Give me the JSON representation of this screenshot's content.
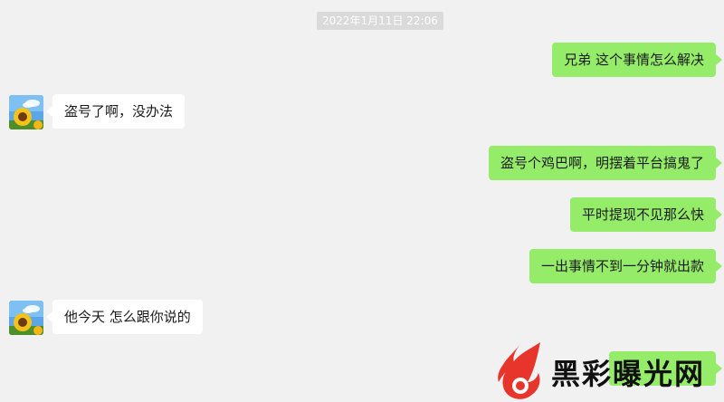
{
  "chat": {
    "timestamp": "2022年1月11日 22:06",
    "messages": [
      {
        "side": "out",
        "text": "兄弟 这个事情怎么解决"
      },
      {
        "side": "in",
        "text": "盗号了啊，没办法"
      },
      {
        "side": "out",
        "text": "盗号个鸡巴啊，明摆着平台搞鬼了"
      },
      {
        "side": "out",
        "text": "平时提现不见那么快"
      },
      {
        "side": "out",
        "text": "一出事情不到一分钟就出款"
      },
      {
        "side": "in",
        "text": "他今天 怎么跟你说的"
      }
    ]
  },
  "watermark": {
    "text": "黑彩曝光网"
  },
  "colors": {
    "background": "#f1f1f1",
    "outgoing_bubble": "#95ec69",
    "incoming_bubble": "#ffffff",
    "watermark_red": "#e8352b"
  }
}
